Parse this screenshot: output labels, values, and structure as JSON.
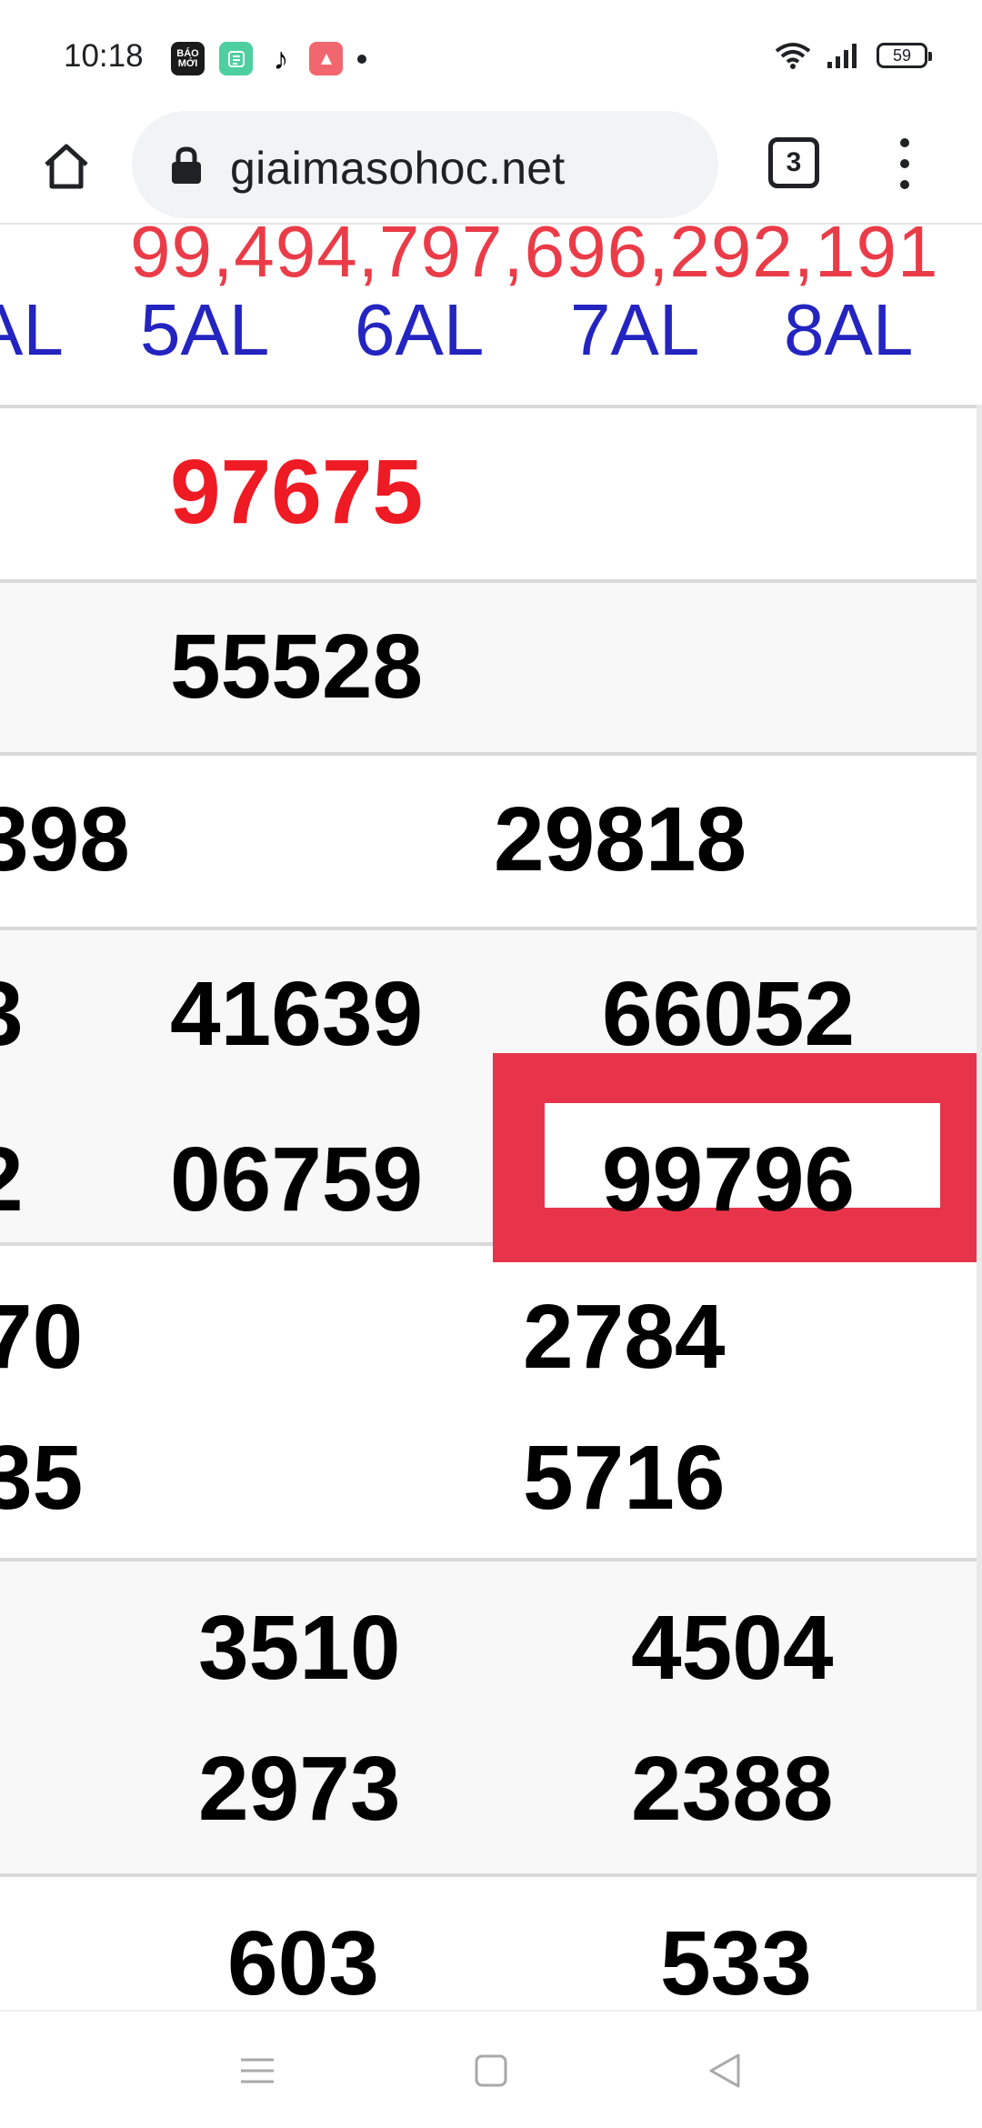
{
  "status_bar": {
    "time": "10:18",
    "notifications": [
      {
        "name": "baomoi-app-icon",
        "label": "BÁO MỚI"
      },
      {
        "name": "green-app-icon",
        "label": ""
      },
      {
        "name": "tiktok-icon",
        "label": "♪"
      },
      {
        "name": "pink-app-icon",
        "label": ""
      }
    ],
    "battery_level": "59",
    "icons": [
      "wifi-icon",
      "signal-icon",
      "battery-icon"
    ]
  },
  "browser": {
    "url": "giaimasohoc.net",
    "tab_count": "3",
    "icons": [
      "home-icon",
      "lock-icon",
      "more-vert-icon"
    ]
  },
  "page": {
    "marquee": "99,494,797,696,292,191",
    "columns": [
      "AL",
      "5AL",
      "6AL",
      "7AL",
      "8AL"
    ],
    "rows": {
      "r1": [
        "97675"
      ],
      "r2": [
        "55528"
      ],
      "r3": [
        "398",
        "29818"
      ],
      "r4a": [
        "3",
        "41639",
        "66052"
      ],
      "r4b": [
        "2",
        "06759",
        "99796"
      ],
      "r5a": [
        "70",
        "2784"
      ],
      "r5b": [
        "35",
        "5716"
      ],
      "r6a": [
        "3510",
        "4504"
      ],
      "r6b": [
        "2973",
        "2388"
      ],
      "r7": [
        "603",
        "533"
      ]
    },
    "colors": {
      "header_blue": "#2424c0",
      "marquee_red": "#ea3c48",
      "special_red": "#ee1b24",
      "highlight_red": "#e8344a"
    }
  },
  "nav_bar": {
    "icons": [
      "menu-icon",
      "home-square-icon",
      "back-icon"
    ]
  }
}
